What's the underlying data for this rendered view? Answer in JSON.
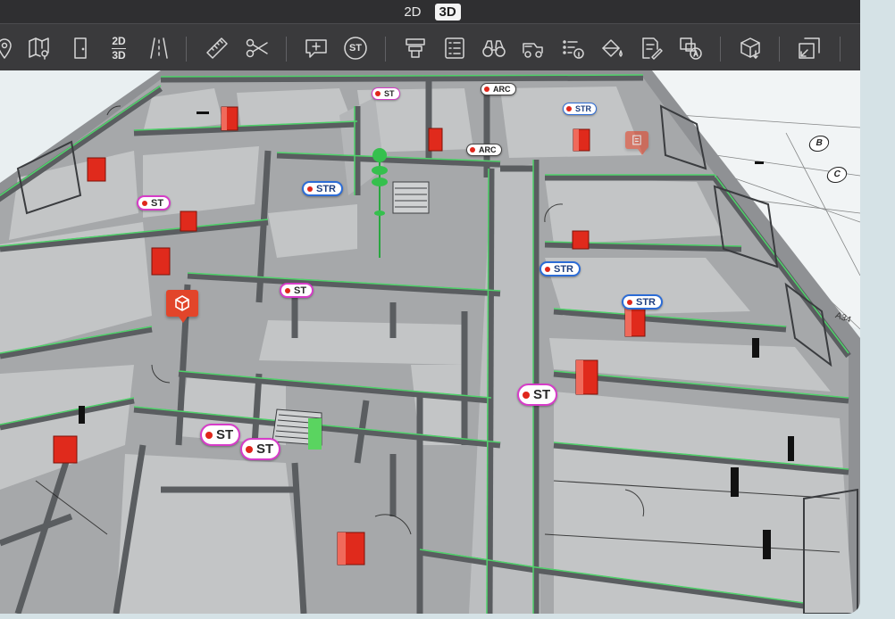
{
  "view_modes": {
    "mode_2d": "2D",
    "mode_3d": "3D",
    "active": "3D"
  },
  "toolbar": {
    "tools": [
      {
        "id": "location",
        "icon": "map-pin-icon"
      },
      {
        "id": "map",
        "icon": "map-location-icon"
      },
      {
        "id": "door",
        "icon": "door-icon"
      },
      {
        "id": "toggle-2d3d",
        "icon": "2d-3d-toggle-icon",
        "label_top": "2D",
        "label_bottom": "3D"
      },
      {
        "id": "road",
        "icon": "road-icon"
      },
      {
        "id": "measure",
        "icon": "ruler-icon"
      },
      {
        "id": "cut",
        "icon": "scissors-icon"
      },
      {
        "id": "add-comment",
        "icon": "add-comment-icon"
      },
      {
        "id": "stamp",
        "icon": "stamp-icon",
        "label": "ST"
      },
      {
        "id": "layers-stack",
        "icon": "layers-stack-icon"
      },
      {
        "id": "checklist",
        "icon": "checklist-icon"
      },
      {
        "id": "binoculars",
        "icon": "binoculars-icon"
      },
      {
        "id": "vehicle",
        "icon": "vehicle-icon"
      },
      {
        "id": "info-list",
        "icon": "info-list-icon"
      },
      {
        "id": "paint-bucket",
        "icon": "paint-bucket-icon"
      },
      {
        "id": "edit-document",
        "icon": "edit-document-icon"
      },
      {
        "id": "shape-a",
        "icon": "shape-text-icon"
      },
      {
        "id": "cube-measure",
        "icon": "cube-measure-icon"
      },
      {
        "id": "fit-view",
        "icon": "fit-view-icon"
      }
    ]
  },
  "markers": [
    {
      "label": "ST",
      "kind": "st",
      "size": "sm"
    },
    {
      "label": "ARC",
      "kind": "arc",
      "size": "sm"
    },
    {
      "label": "STR",
      "kind": "str",
      "size": "sm"
    },
    {
      "label": "ARC",
      "kind": "arc",
      "size": "sm"
    },
    {
      "label": "STR",
      "kind": "str",
      "size": "md"
    },
    {
      "label": "ST",
      "kind": "st",
      "size": "md"
    },
    {
      "label": "STR",
      "kind": "str",
      "size": "md"
    },
    {
      "label": "ST",
      "kind": "st",
      "size": "md"
    },
    {
      "label": "STR",
      "kind": "str",
      "size": "md"
    },
    {
      "label": "ST",
      "kind": "st",
      "size": "lg"
    },
    {
      "label": "ST",
      "kind": "st",
      "size": "lg"
    },
    {
      "label": "ST",
      "kind": "st",
      "size": "lg"
    }
  ],
  "grid_bubbles": [
    "B",
    "C"
  ],
  "grid_texts": [
    "A34"
  ]
}
